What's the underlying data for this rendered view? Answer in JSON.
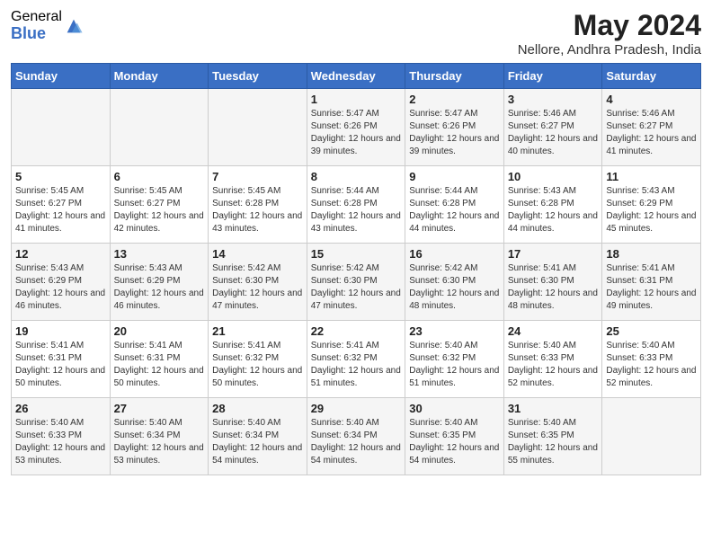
{
  "logo": {
    "general": "General",
    "blue": "Blue"
  },
  "title": "May 2024",
  "subtitle": "Nellore, Andhra Pradesh, India",
  "days_of_week": [
    "Sunday",
    "Monday",
    "Tuesday",
    "Wednesday",
    "Thursday",
    "Friday",
    "Saturday"
  ],
  "weeks": [
    [
      {
        "day": "",
        "info": ""
      },
      {
        "day": "",
        "info": ""
      },
      {
        "day": "",
        "info": ""
      },
      {
        "day": "1",
        "info": "Sunrise: 5:47 AM\nSunset: 6:26 PM\nDaylight: 12 hours and 39 minutes."
      },
      {
        "day": "2",
        "info": "Sunrise: 5:47 AM\nSunset: 6:26 PM\nDaylight: 12 hours and 39 minutes."
      },
      {
        "day": "3",
        "info": "Sunrise: 5:46 AM\nSunset: 6:27 PM\nDaylight: 12 hours and 40 minutes."
      },
      {
        "day": "4",
        "info": "Sunrise: 5:46 AM\nSunset: 6:27 PM\nDaylight: 12 hours and 41 minutes."
      }
    ],
    [
      {
        "day": "5",
        "info": "Sunrise: 5:45 AM\nSunset: 6:27 PM\nDaylight: 12 hours and 41 minutes."
      },
      {
        "day": "6",
        "info": "Sunrise: 5:45 AM\nSunset: 6:27 PM\nDaylight: 12 hours and 42 minutes."
      },
      {
        "day": "7",
        "info": "Sunrise: 5:45 AM\nSunset: 6:28 PM\nDaylight: 12 hours and 43 minutes."
      },
      {
        "day": "8",
        "info": "Sunrise: 5:44 AM\nSunset: 6:28 PM\nDaylight: 12 hours and 43 minutes."
      },
      {
        "day": "9",
        "info": "Sunrise: 5:44 AM\nSunset: 6:28 PM\nDaylight: 12 hours and 44 minutes."
      },
      {
        "day": "10",
        "info": "Sunrise: 5:43 AM\nSunset: 6:28 PM\nDaylight: 12 hours and 44 minutes."
      },
      {
        "day": "11",
        "info": "Sunrise: 5:43 AM\nSunset: 6:29 PM\nDaylight: 12 hours and 45 minutes."
      }
    ],
    [
      {
        "day": "12",
        "info": "Sunrise: 5:43 AM\nSunset: 6:29 PM\nDaylight: 12 hours and 46 minutes."
      },
      {
        "day": "13",
        "info": "Sunrise: 5:43 AM\nSunset: 6:29 PM\nDaylight: 12 hours and 46 minutes."
      },
      {
        "day": "14",
        "info": "Sunrise: 5:42 AM\nSunset: 6:30 PM\nDaylight: 12 hours and 47 minutes."
      },
      {
        "day": "15",
        "info": "Sunrise: 5:42 AM\nSunset: 6:30 PM\nDaylight: 12 hours and 47 minutes."
      },
      {
        "day": "16",
        "info": "Sunrise: 5:42 AM\nSunset: 6:30 PM\nDaylight: 12 hours and 48 minutes."
      },
      {
        "day": "17",
        "info": "Sunrise: 5:41 AM\nSunset: 6:30 PM\nDaylight: 12 hours and 48 minutes."
      },
      {
        "day": "18",
        "info": "Sunrise: 5:41 AM\nSunset: 6:31 PM\nDaylight: 12 hours and 49 minutes."
      }
    ],
    [
      {
        "day": "19",
        "info": "Sunrise: 5:41 AM\nSunset: 6:31 PM\nDaylight: 12 hours and 50 minutes."
      },
      {
        "day": "20",
        "info": "Sunrise: 5:41 AM\nSunset: 6:31 PM\nDaylight: 12 hours and 50 minutes."
      },
      {
        "day": "21",
        "info": "Sunrise: 5:41 AM\nSunset: 6:32 PM\nDaylight: 12 hours and 50 minutes."
      },
      {
        "day": "22",
        "info": "Sunrise: 5:41 AM\nSunset: 6:32 PM\nDaylight: 12 hours and 51 minutes."
      },
      {
        "day": "23",
        "info": "Sunrise: 5:40 AM\nSunset: 6:32 PM\nDaylight: 12 hours and 51 minutes."
      },
      {
        "day": "24",
        "info": "Sunrise: 5:40 AM\nSunset: 6:33 PM\nDaylight: 12 hours and 52 minutes."
      },
      {
        "day": "25",
        "info": "Sunrise: 5:40 AM\nSunset: 6:33 PM\nDaylight: 12 hours and 52 minutes."
      }
    ],
    [
      {
        "day": "26",
        "info": "Sunrise: 5:40 AM\nSunset: 6:33 PM\nDaylight: 12 hours and 53 minutes."
      },
      {
        "day": "27",
        "info": "Sunrise: 5:40 AM\nSunset: 6:34 PM\nDaylight: 12 hours and 53 minutes."
      },
      {
        "day": "28",
        "info": "Sunrise: 5:40 AM\nSunset: 6:34 PM\nDaylight: 12 hours and 54 minutes."
      },
      {
        "day": "29",
        "info": "Sunrise: 5:40 AM\nSunset: 6:34 PM\nDaylight: 12 hours and 54 minutes."
      },
      {
        "day": "30",
        "info": "Sunrise: 5:40 AM\nSunset: 6:35 PM\nDaylight: 12 hours and 54 minutes."
      },
      {
        "day": "31",
        "info": "Sunrise: 5:40 AM\nSunset: 6:35 PM\nDaylight: 12 hours and 55 minutes."
      },
      {
        "day": "",
        "info": ""
      }
    ]
  ]
}
